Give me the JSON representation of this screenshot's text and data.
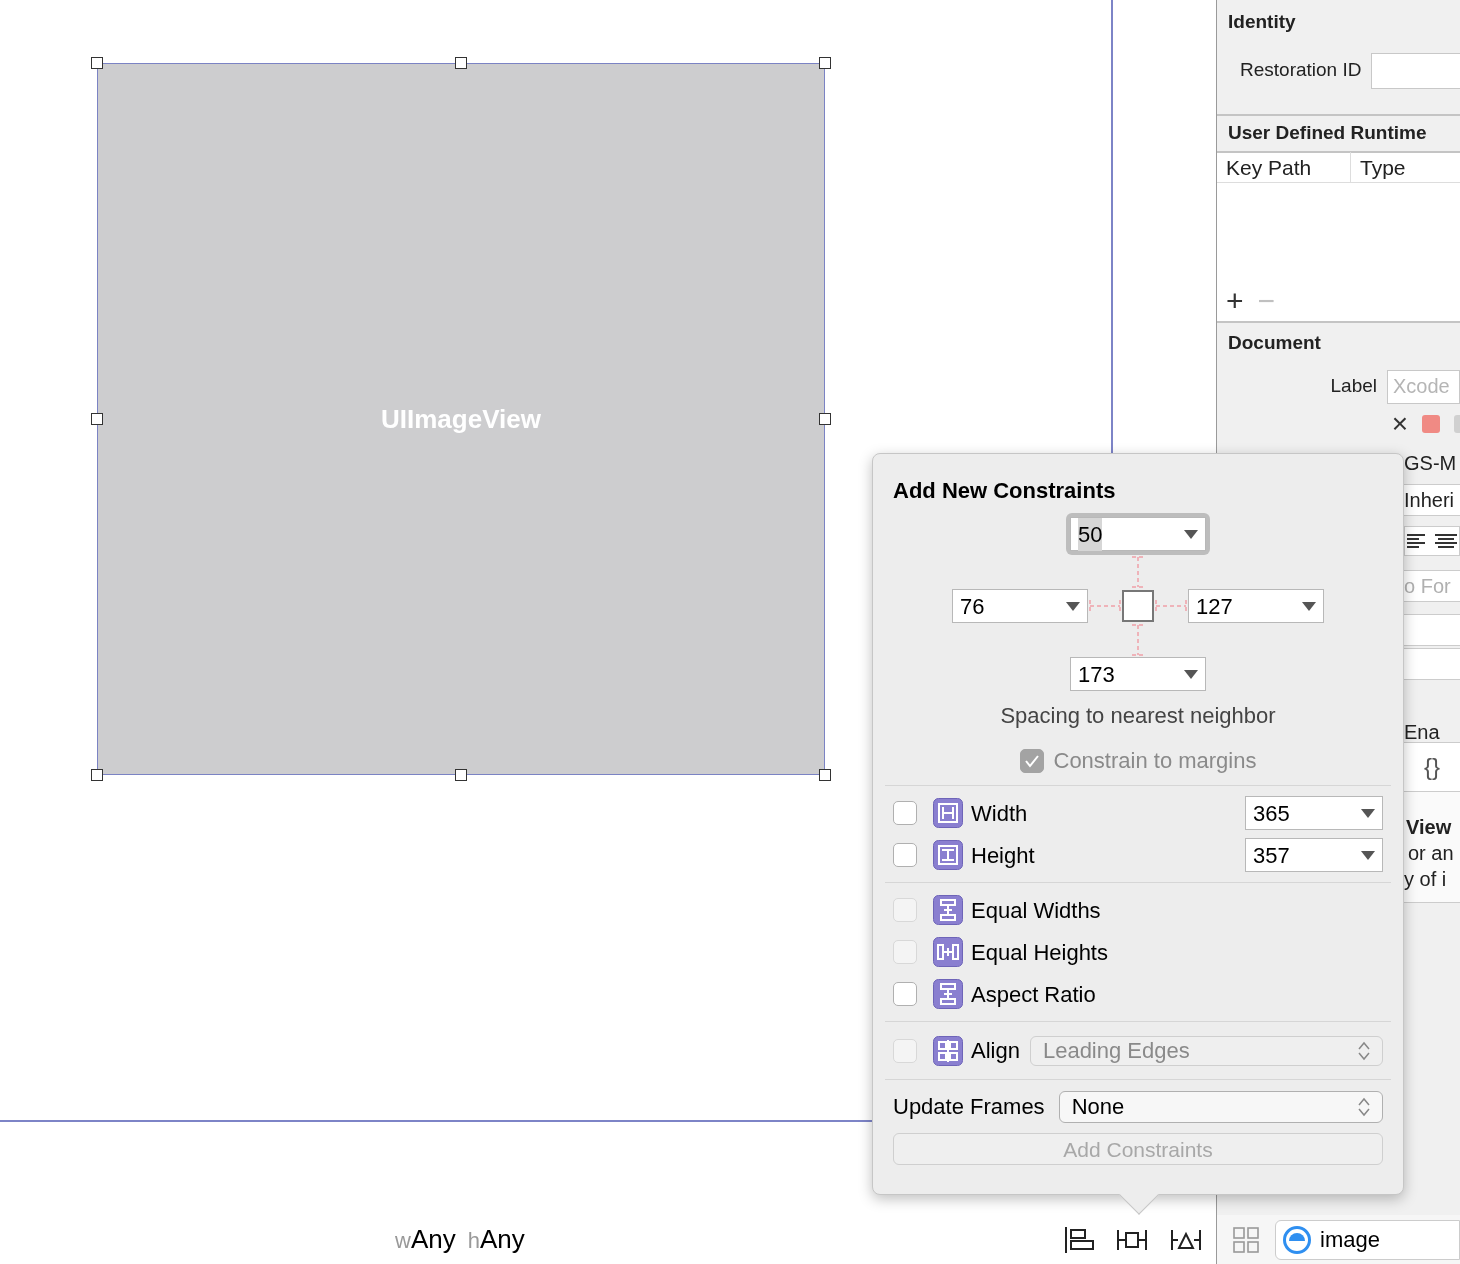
{
  "canvas": {
    "view_label": "UIImageView"
  },
  "inspector": {
    "identity": {
      "title": "Identity",
      "restoration_id_label": "Restoration ID"
    },
    "runtime_attributes": {
      "title": "User Defined Runtime",
      "columns": [
        "Key Path",
        "Type"
      ],
      "add_symbol": "+",
      "remove_symbol": "−"
    },
    "document": {
      "title": "Document",
      "label_label": "Label",
      "label_placeholder": "Xcode",
      "clear_symbol": "×"
    },
    "cut_off": {
      "object_id": "GS-M",
      "inherit": "Inheri",
      "font_placeholder": "o For",
      "enabled_label": "Ena",
      "braces": "{}",
      "view_title": "View",
      "text_line_1": "or an",
      "text_line_2": "y of i"
    }
  },
  "popover": {
    "title": "Add New Constraints",
    "spacing": {
      "top": {
        "value": "50",
        "focused": true
      },
      "left": {
        "value": "76",
        "focused": false
      },
      "right": {
        "value": "127",
        "focused": false
      },
      "bottom": {
        "value": "173",
        "focused": false
      }
    },
    "spacing_caption": "Spacing to nearest neighbor",
    "constrain_to_margins": {
      "label": "Constrain to margins",
      "checked": true,
      "disabled": true
    },
    "size_rows": [
      {
        "label": "Width",
        "value": "365",
        "checked": false
      },
      {
        "label": "Height",
        "value": "357",
        "checked": false
      }
    ],
    "relation_rows": [
      {
        "label": "Equal Widths",
        "checked": false,
        "disabled": true
      },
      {
        "label": "Equal Heights",
        "checked": false,
        "disabled": true
      },
      {
        "label": "Aspect Ratio",
        "checked": false,
        "disabled": false
      }
    ],
    "align": {
      "label": "Align",
      "checked": false,
      "disabled": true,
      "value": "Leading Edges"
    },
    "update_frames": {
      "label": "Update Frames",
      "value": "None"
    },
    "add_button": {
      "label": "Add Constraints",
      "disabled": true
    }
  },
  "bottom_bar": {
    "size_class": [
      {
        "prefix": "w",
        "value": "Any"
      },
      {
        "prefix": "h",
        "value": "Any"
      }
    ],
    "filter_value": "image"
  }
}
